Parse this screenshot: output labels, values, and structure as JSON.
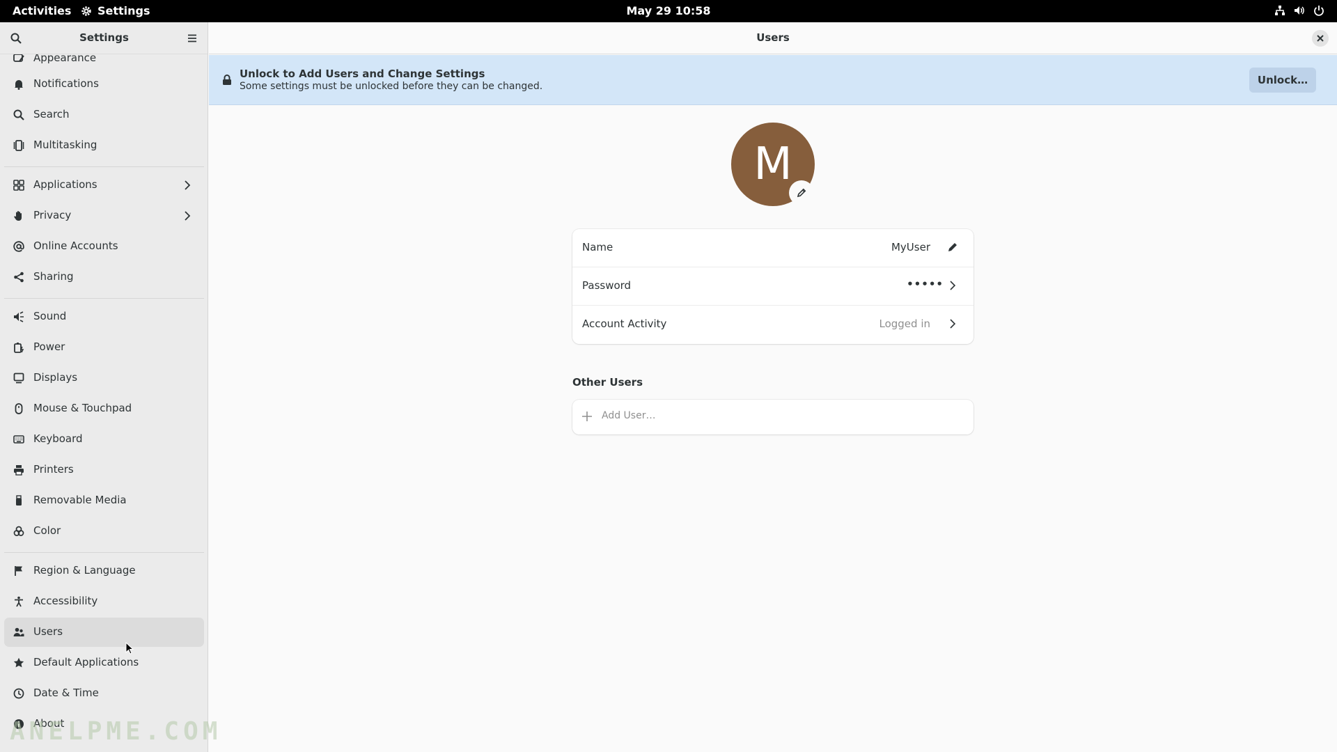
{
  "topbar": {
    "activities": "Activities",
    "app_name": "Settings",
    "clock": "May 29  10:58"
  },
  "sidebar": {
    "title": "Settings",
    "items": [
      {
        "label": "Appearance",
        "icon": "appearance-icon"
      },
      {
        "label": "Notifications",
        "icon": "bell-icon"
      },
      {
        "label": "Search",
        "icon": "search-icon"
      },
      {
        "label": "Multitasking",
        "icon": "multitasking-icon"
      },
      {
        "label": "Applications",
        "icon": "applications-icon"
      },
      {
        "label": "Privacy",
        "icon": "hand-icon"
      },
      {
        "label": "Online Accounts",
        "icon": "at-icon"
      },
      {
        "label": "Sharing",
        "icon": "share-icon"
      },
      {
        "label": "Sound",
        "icon": "speaker-icon"
      },
      {
        "label": "Power",
        "icon": "battery-icon"
      },
      {
        "label": "Displays",
        "icon": "display-icon"
      },
      {
        "label": "Mouse & Touchpad",
        "icon": "mouse-icon"
      },
      {
        "label": "Keyboard",
        "icon": "keyboard-icon"
      },
      {
        "label": "Printers",
        "icon": "printer-icon"
      },
      {
        "label": "Removable Media",
        "icon": "usb-icon"
      },
      {
        "label": "Color",
        "icon": "color-icon"
      },
      {
        "label": "Region & Language",
        "icon": "flag-icon"
      },
      {
        "label": "Accessibility",
        "icon": "accessibility-icon"
      },
      {
        "label": "Users",
        "icon": "users-icon",
        "active": true
      },
      {
        "label": "Default Applications",
        "icon": "star-icon"
      },
      {
        "label": "Date & Time",
        "icon": "clock-icon"
      },
      {
        "label": "About",
        "icon": "info-icon"
      }
    ]
  },
  "main": {
    "title": "Users",
    "banner": {
      "title": "Unlock to Add Users and Change Settings",
      "subtitle": "Some settings must be unlocked before they can be changed.",
      "button": "Unlock…"
    },
    "avatar_letter": "M",
    "avatar_color": "#865e3c",
    "account": {
      "name_label": "Name",
      "name_value": "MyUser",
      "password_label": "Password",
      "password_value": "•••••",
      "activity_label": "Account Activity",
      "activity_value": "Logged in"
    },
    "other_users": {
      "title": "Other Users",
      "add_label": "Add User…"
    }
  },
  "watermark": "ANELPME.COM"
}
